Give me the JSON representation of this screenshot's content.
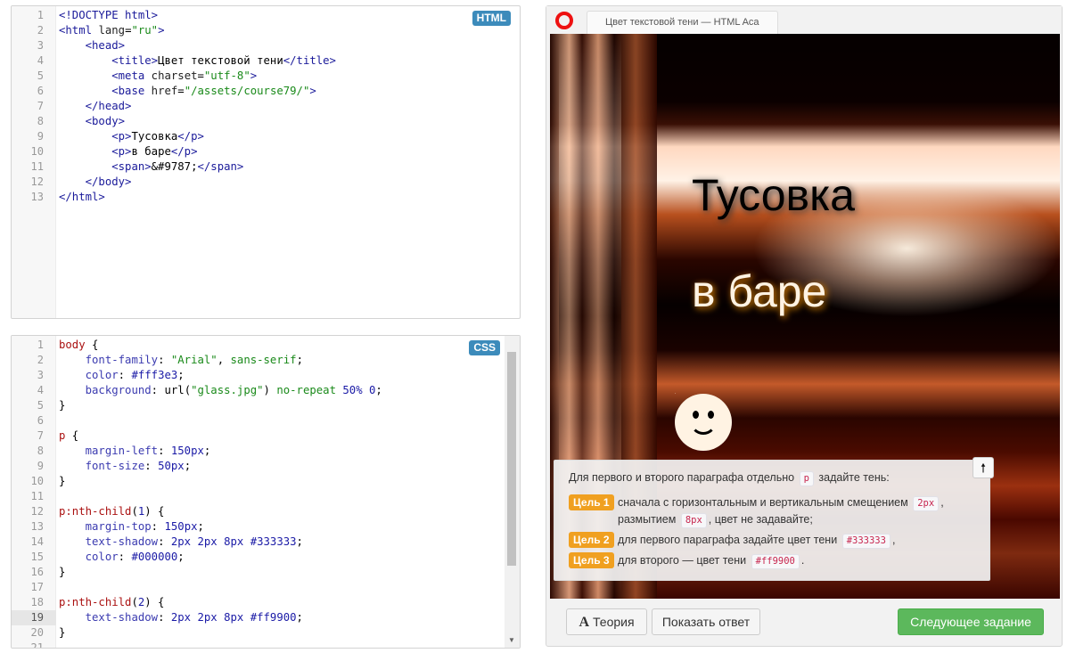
{
  "html_editor": {
    "badge": "HTML",
    "lines": [
      {
        "n": "1",
        "html": "<span class='tg'>&lt;!DOCTYPE html&gt;</span>"
      },
      {
        "n": "2",
        "html": "<span class='tg'>&lt;html</span> <span class='at'>lang</span>=<span class='st'>\"ru\"</span><span class='tg'>&gt;</span>"
      },
      {
        "n": "3",
        "html": "    <span class='tg'>&lt;head&gt;</span>"
      },
      {
        "n": "4",
        "html": "        <span class='tg'>&lt;title&gt;</span>Цвет текстовой тени<span class='tg'>&lt;/title&gt;</span>"
      },
      {
        "n": "5",
        "html": "        <span class='tg'>&lt;meta</span> <span class='at'>charset</span>=<span class='st'>\"utf-8\"</span><span class='tg'>&gt;</span>"
      },
      {
        "n": "6",
        "html": "        <span class='tg'>&lt;base</span> <span class='at'>href</span>=<span class='st'>\"/assets/course79/\"</span><span class='tg'>&gt;</span>"
      },
      {
        "n": "7",
        "html": "    <span class='tg'>&lt;/head&gt;</span>"
      },
      {
        "n": "8",
        "html": "    <span class='tg'>&lt;body&gt;</span>"
      },
      {
        "n": "9",
        "html": "        <span class='tg'>&lt;p&gt;</span>Тусовка<span class='tg'>&lt;/p&gt;</span>"
      },
      {
        "n": "10",
        "html": "        <span class='tg'>&lt;p&gt;</span>в баре<span class='tg'>&lt;/p&gt;</span>"
      },
      {
        "n": "11",
        "html": "        <span class='tg'>&lt;span&gt;</span>&amp;#9787;<span class='tg'>&lt;/span&gt;</span>"
      },
      {
        "n": "12",
        "html": "    <span class='tg'>&lt;/body&gt;</span>"
      },
      {
        "n": "13",
        "html": "<span class='tg'>&lt;/html&gt;</span>"
      }
    ]
  },
  "css_editor": {
    "badge": "CSS",
    "active_line": "19",
    "lines": [
      {
        "n": "1",
        "html": "<span class='sel'>body</span> {"
      },
      {
        "n": "2",
        "html": "    <span class='pr'>font-family</span>: <span class='st'>\"Arial\"</span>, <span class='st'>sans-serif</span>;"
      },
      {
        "n": "3",
        "html": "    <span class='pr'>color</span>: <span class='nu'>#fff3e3</span>;"
      },
      {
        "n": "4",
        "html": "    <span class='pr'>background</span>: url(<span class='st'>\"glass.jpg\"</span>) <span class='st'>no-repeat</span> <span class='nu'>50%</span> <span class='nu'>0</span>;"
      },
      {
        "n": "5",
        "html": "}"
      },
      {
        "n": "6",
        "html": ""
      },
      {
        "n": "7",
        "html": "<span class='sel'>p</span> {"
      },
      {
        "n": "8",
        "html": "    <span class='pr'>margin-left</span>: <span class='nu'>150px</span>;"
      },
      {
        "n": "9",
        "html": "    <span class='pr'>font-size</span>: <span class='nu'>50px</span>;"
      },
      {
        "n": "10",
        "html": "}"
      },
      {
        "n": "11",
        "html": ""
      },
      {
        "n": "12",
        "html": "<span class='sel'>p:nth-child</span>(<span class='nu'>1</span>) {"
      },
      {
        "n": "13",
        "html": "    <span class='pr'>margin-top</span>: <span class='nu'>150px</span>;"
      },
      {
        "n": "14",
        "html": "    <span class='pr'>text-shadow</span>: <span class='nu'>2px 2px 8px #333333</span>;"
      },
      {
        "n": "15",
        "html": "    <span class='pr'>color</span>: <span class='nu'>#000000</span>;"
      },
      {
        "n": "16",
        "html": "}"
      },
      {
        "n": "17",
        "html": ""
      },
      {
        "n": "18",
        "html": "<span class='sel'>p:nth-child</span>(<span class='nu'>2</span>) {"
      },
      {
        "n": "19",
        "html": "    <span class='pr'>text-shadow</span>: <span class='nu'>2px 2px 8px #ff9900</span>;"
      },
      {
        "n": "20",
        "html": "}"
      },
      {
        "n": "21",
        "html": ""
      }
    ]
  },
  "browser": {
    "tab_title": "Цвет текстовой тени — HTML Aca",
    "p1": "Тусовка",
    "p2": "в баре",
    "smiley": "☻"
  },
  "tasks": {
    "intro_before": "Для первого и второго параграфа отдельно",
    "intro_code": "p",
    "intro_after": "задайте тень:",
    "goals": [
      {
        "tag": "Цель 1",
        "t1": "сначала с горизонтальным и вертикальным смещением",
        "c1": "2px",
        "t2": ",",
        "t3": "размытием",
        "c2": "8px",
        "t4": ", цвет не задавайте;"
      },
      {
        "tag": "Цель 2",
        "t1": "для первого параграфа задайте цвет тени",
        "c1": "#333333",
        "t2": ","
      },
      {
        "tag": "Цель 3",
        "t1": "для второго — цвет тени",
        "c1": "#ff9900",
        "t2": "."
      }
    ]
  },
  "buttons": {
    "theory_icon": "A",
    "theory": "Теория",
    "answer": "Показать ответ",
    "next": "Следующее задание"
  },
  "colors": {
    "badge": "#3c8bbb",
    "goal_tag": "#f0a020",
    "next_button": "#5cb85c",
    "opera_red": "#e11111"
  }
}
